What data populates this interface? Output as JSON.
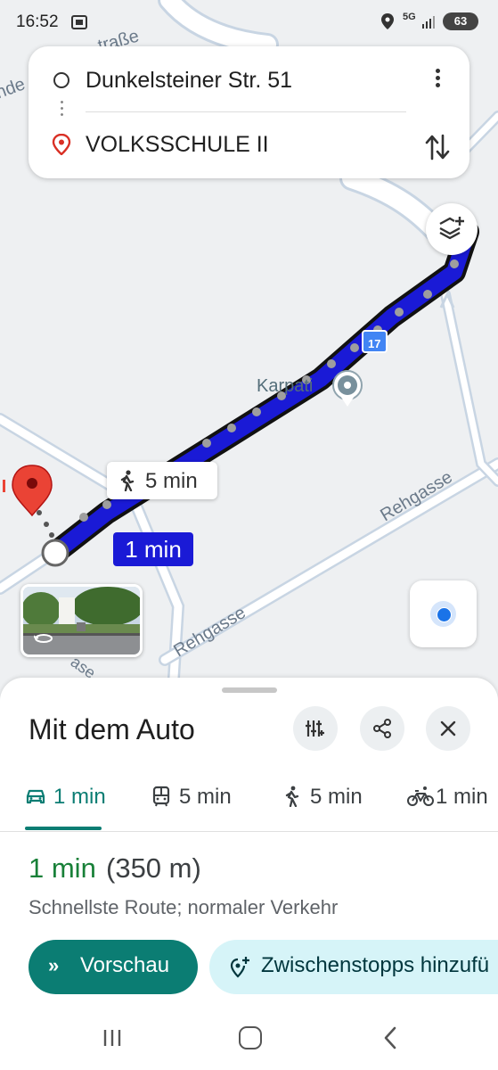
{
  "status_bar": {
    "time": "16:52",
    "network": "5G",
    "battery": "63"
  },
  "route_card": {
    "origin": "Dunkelsteiner Str. 51",
    "destination": "VOLKSSCHULE II"
  },
  "map": {
    "street_labels": [
      "traße",
      "nde",
      "Rehgasse",
      "Rehgasse",
      "ase"
    ],
    "road_badge": "17",
    "poi_label": "Karpati",
    "walk_chip": "5 min",
    "drive_chip": "1 min",
    "route_color": "#1a1ad6"
  },
  "sheet": {
    "title": "Mit dem Auto",
    "modes": [
      {
        "icon": "car-icon",
        "label": "1 min"
      },
      {
        "icon": "transit-icon",
        "label": "5 min"
      },
      {
        "icon": "walk-icon",
        "label": "5 min"
      },
      {
        "icon": "bike-icon",
        "label": "1 min"
      }
    ],
    "active_mode": "car",
    "route_time": "1 min",
    "route_distance": "(350 m)",
    "route_description": "Schnellste Route; normaler Verkehr",
    "preview_label": "Vorschau",
    "stops_label": "Zwischenstopps hinzufü",
    "accent_color": "#0b7d73"
  }
}
